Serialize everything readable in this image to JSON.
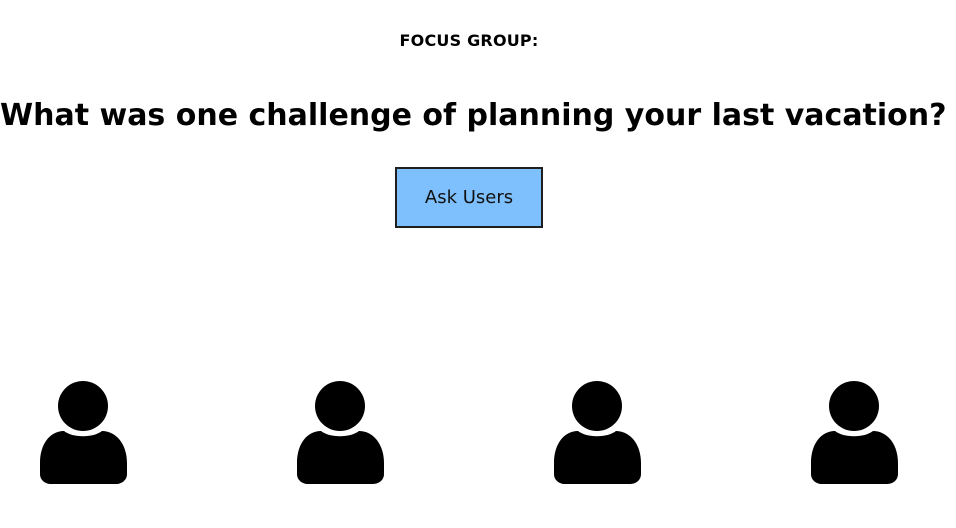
{
  "header": {
    "eyebrow": "FOCUS GROUP:",
    "question": "What was one challenge of planning your last vacation?"
  },
  "actions": {
    "ask_label": "Ask Users",
    "ask_button_color": "#7ec0fd"
  },
  "users": {
    "icon": "user-silhouette-icon",
    "count": 4,
    "color": "#000000"
  }
}
